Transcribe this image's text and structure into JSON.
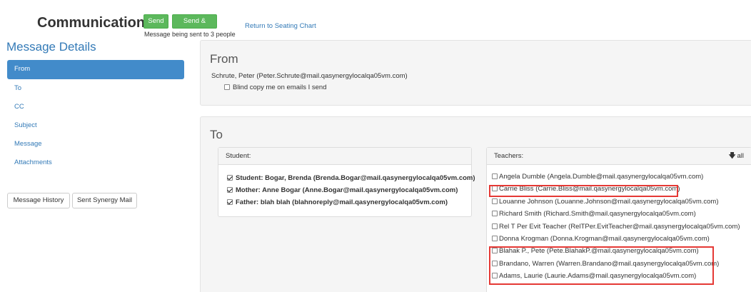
{
  "header": {
    "title": "Communication",
    "send_label": "Send",
    "send_return_label": "Send & Return",
    "send_note": "Message being sent to 3 people",
    "return_link": "Return to Seating Chart"
  },
  "sidebar": {
    "title": "Message Details",
    "items": [
      {
        "label": "From",
        "active": true
      },
      {
        "label": "To",
        "active": false
      },
      {
        "label": "CC",
        "active": false
      },
      {
        "label": "Subject",
        "active": false
      },
      {
        "label": "Message",
        "active": false
      },
      {
        "label": "Attachments",
        "active": false
      }
    ],
    "history_button": "Message History",
    "sent_mail_button": "Sent Synergy Mail"
  },
  "from": {
    "heading": "From",
    "sender": "Schrute, Peter (Peter.Schrute@mail.qasynergylocalqa05vm.com)",
    "bcc_label": "Blind copy me on emails I send",
    "bcc_checked": false
  },
  "to": {
    "heading": "To",
    "student": {
      "header": "Student:",
      "recipients": [
        {
          "label": "Student: Bogar, Brenda (Brenda.Bogar@mail.qasynergylocalqa05vm.com)",
          "checked": true
        },
        {
          "label": "Mother: Anne Bogar (Anne.Bogar@mail.qasynergylocalqa05vm.com)",
          "checked": true
        },
        {
          "label": "Father: blah blah (blahnoreply@mail.qasynergylocalqa05vm.com)",
          "checked": true
        }
      ]
    },
    "teachers": {
      "header": "Teachers:",
      "all_label": "all",
      "recipients": [
        {
          "label": "Angela Dumble (Angela.Dumble@mail.qasynergylocalqa05vm.com)",
          "checked": false
        },
        {
          "label": "Carrie Bliss (Carrie.Bliss@mail.qasynergylocalqa05vm.com)",
          "checked": false
        },
        {
          "label": "Louanne Johnson (Louanne.Johnson@mail.qasynergylocalqa05vm.com)",
          "checked": false
        },
        {
          "label": "Richard Smith (Richard.Smith@mail.qasynergylocalqa05vm.com)",
          "checked": false
        },
        {
          "label": "Rel T Per Evit Teacher (RelTPer.EvitTeacher@mail.qasynergylocalqa05vm.com)",
          "checked": false
        },
        {
          "label": "Donna Krogman (Donna.Krogman@mail.qasynergylocalqa05vm.com)",
          "checked": false
        },
        {
          "label": "Blahak P., Pete (Pete.BlahakP.@mail.qasynergylocalqa05vm.com)",
          "checked": false
        },
        {
          "label": "Brandano, Warren (Warren.Brandano@mail.qasynergylocalqa05vm.com)",
          "checked": false
        },
        {
          "label": "Adams, Laurie (Laurie.Adams@mail.qasynergylocalqa05vm.com)",
          "checked": false
        }
      ]
    }
  },
  "colors": {
    "accent": "#428bca",
    "link": "#337ab7",
    "send_button": "#5cb85c",
    "highlight_box": "#e53935"
  }
}
